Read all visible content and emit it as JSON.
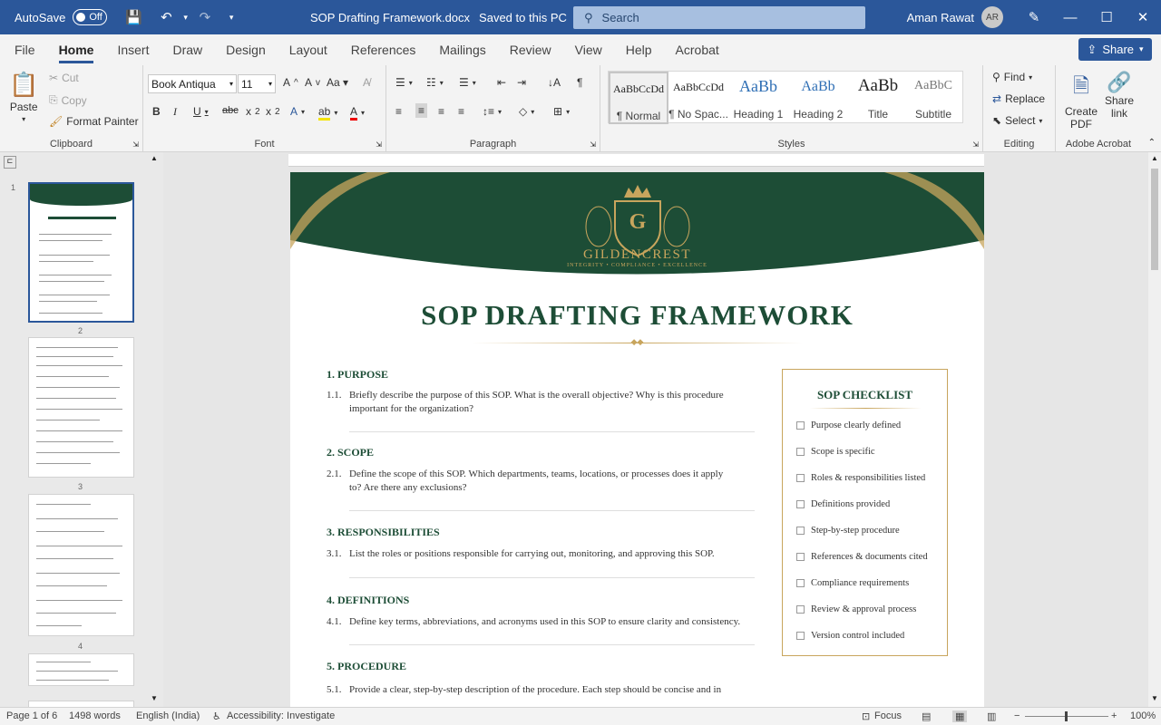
{
  "titlebar": {
    "autosave_label": "AutoSave",
    "autosave_state": "Off",
    "filename": "SOP Drafting Framework.docx",
    "save_status": "Saved to this PC",
    "search_placeholder": "Search",
    "user_name": "Aman Rawat",
    "user_initials": "AR"
  },
  "menu": {
    "tabs": [
      "File",
      "Home",
      "Insert",
      "Draw",
      "Design",
      "Layout",
      "References",
      "Mailings",
      "Review",
      "View",
      "Help",
      "Acrobat"
    ],
    "active": "Home",
    "share_label": "Share"
  },
  "ribbon": {
    "clipboard": {
      "paste": "Paste",
      "cut": "Cut",
      "copy": "Copy",
      "format_painter": "Format Painter",
      "label": "Clipboard"
    },
    "font": {
      "name": "Book Antiqua",
      "size": "11",
      "label": "Font"
    },
    "paragraph": {
      "label": "Paragraph"
    },
    "styles": {
      "label": "Styles",
      "items": [
        {
          "preview": "AaBbCcDd",
          "name": "¶ Normal"
        },
        {
          "preview": "AaBbCcDd",
          "name": "¶ No Spac..."
        },
        {
          "preview": "AaBb",
          "name": "Heading 1"
        },
        {
          "preview": "AaBb",
          "name": "Heading 2"
        },
        {
          "preview": "AaBb",
          "name": "Title"
        },
        {
          "preview": "AaBbC",
          "name": "Subtitle"
        }
      ]
    },
    "editing": {
      "find": "Find",
      "replace": "Replace",
      "select": "Select",
      "label": "Editing"
    },
    "acrobat": {
      "create_pdf_1": "Create",
      "create_pdf_2": "PDF",
      "share_link_1": "Share",
      "share_link_2": "link",
      "label": "Adobe Acrobat"
    }
  },
  "nav": {
    "page_numbers": [
      "1",
      "2",
      "3",
      "4"
    ]
  },
  "document": {
    "brand": "GILDENCREST",
    "tagline": "INTEGRITY • COMPLIANCE • EXCELLENCE",
    "monogram": "G",
    "title": "SOP DRAFTING FRAMEWORK",
    "sections": [
      {
        "heading": "1.  PURPOSE",
        "num": "1.1.",
        "text": "Briefly describe the purpose of this SOP. What is the overall objective? Why is this procedure important for the organization?"
      },
      {
        "heading": "2.  SCOPE",
        "num": "2.1.",
        "text": "Define the scope of this SOP. Which departments, teams, locations, or processes does it apply to? Are there any exclusions?"
      },
      {
        "heading": "3.  RESPONSIBILITIES",
        "num": "3.1.",
        "text": "List the roles or positions responsible for carrying out, monitoring, and approving this SOP."
      },
      {
        "heading": "4.  DEFINITIONS",
        "num": "4.1.",
        "text": "Define key terms, abbreviations, and acronyms used in this SOP to ensure clarity and consistency."
      },
      {
        "heading": "5.  PROCEDURE",
        "num": "5.1.",
        "text": "Provide a clear, step-by-step description of the procedure. Each step should be concise and in"
      }
    ],
    "checklist": {
      "title": "SOP CHECKLIST",
      "items": [
        "Purpose clearly defined",
        "Scope is specific",
        "Roles & responsibilities listed",
        "Definitions provided",
        "Step-by-step procedure",
        "References & documents cited",
        "Compliance requirements",
        "Review & approval process",
        "Version control included"
      ]
    }
  },
  "status": {
    "page": "Page 1 of 6",
    "words": "1498 words",
    "language": "English (India)",
    "accessibility": "Accessibility: Investigate",
    "focus": "Focus",
    "zoom": "100%"
  },
  "colors": {
    "word_blue": "#2b579a",
    "banner_green": "#1d4d36",
    "gold": "#c8a55d"
  }
}
